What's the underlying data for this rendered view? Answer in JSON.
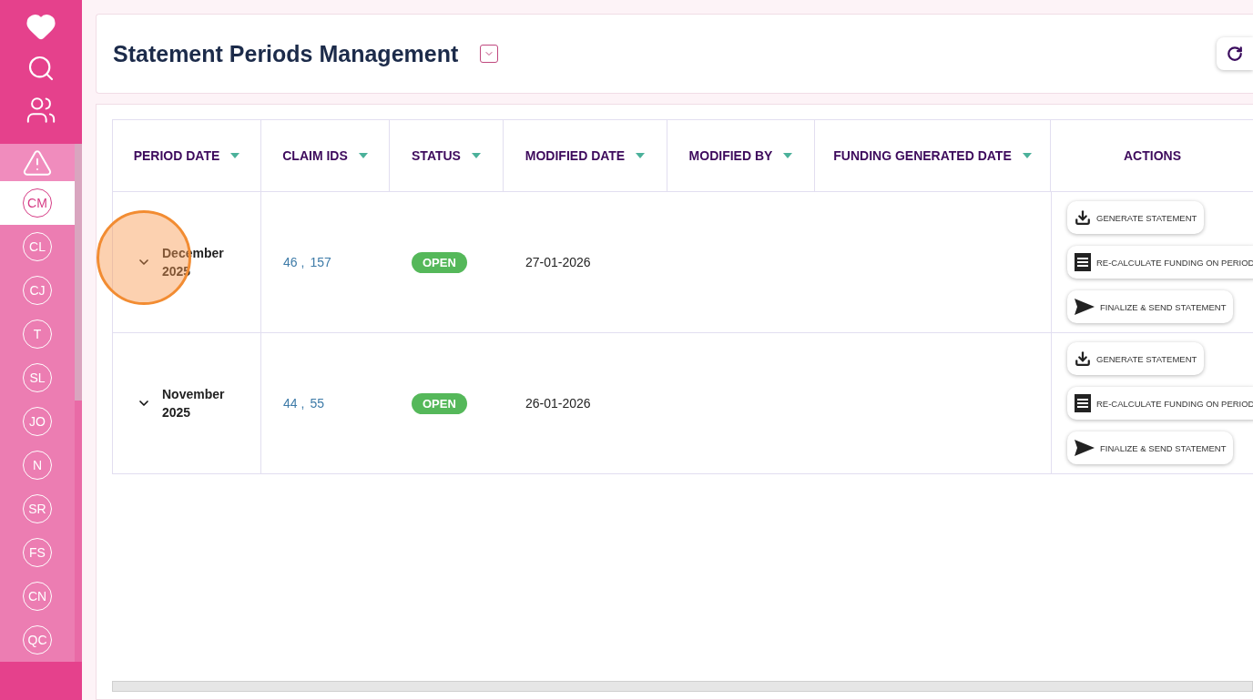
{
  "sidebar": {
    "avatars": [
      {
        "label": "CM",
        "selected": true
      },
      {
        "label": "CL",
        "selected": false
      },
      {
        "label": "CJ",
        "selected": false
      },
      {
        "label": "T",
        "selected": false
      },
      {
        "label": "SL",
        "selected": false
      },
      {
        "label": "JO",
        "selected": false
      },
      {
        "label": "N",
        "selected": false
      },
      {
        "label": "SR",
        "selected": false
      },
      {
        "label": "FS",
        "selected": false
      },
      {
        "label": "CN",
        "selected": false
      },
      {
        "label": "QC",
        "selected": false
      }
    ]
  },
  "header": {
    "title": "Statement Periods Management"
  },
  "table": {
    "columns": [
      {
        "label": "PERIOD DATE",
        "sortable": true
      },
      {
        "label": "CLAIM IDS",
        "sortable": true
      },
      {
        "label": "STATUS",
        "sortable": true
      },
      {
        "label": "MODIFIED DATE",
        "sortable": true
      },
      {
        "label": "MODIFIED BY",
        "sortable": true
      },
      {
        "label": "FUNDING GENERATED DATE",
        "sortable": true
      },
      {
        "label": "ACTIONS",
        "sortable": false
      }
    ],
    "rows": [
      {
        "period": "December 2025",
        "click_marker": true,
        "claim_ids": [
          "46",
          "157"
        ],
        "id_separator": ",",
        "status": "OPEN",
        "modified_date": "27-01-2026",
        "actions": [
          {
            "kind": "download",
            "label": "GENERATE STATEMENT"
          },
          {
            "kind": "recalculate",
            "label": "RE-CALCULATE FUNDING ON PERIOD"
          },
          {
            "kind": "send",
            "label": "FINALIZE & SEND STATEMENT"
          }
        ]
      },
      {
        "period": "November 2025",
        "click_marker": false,
        "claim_ids": [
          "44",
          "55"
        ],
        "id_separator": ",",
        "status": "OPEN",
        "modified_date": "26-01-2026",
        "actions": [
          {
            "kind": "download",
            "label": "GENERATE STATEMENT"
          },
          {
            "kind": "recalculate",
            "label": "RE-CALCULATE FUNDING ON PERIOD"
          },
          {
            "kind": "send",
            "label": "FINALIZE & SEND STATEMENT"
          }
        ]
      }
    ]
  }
}
